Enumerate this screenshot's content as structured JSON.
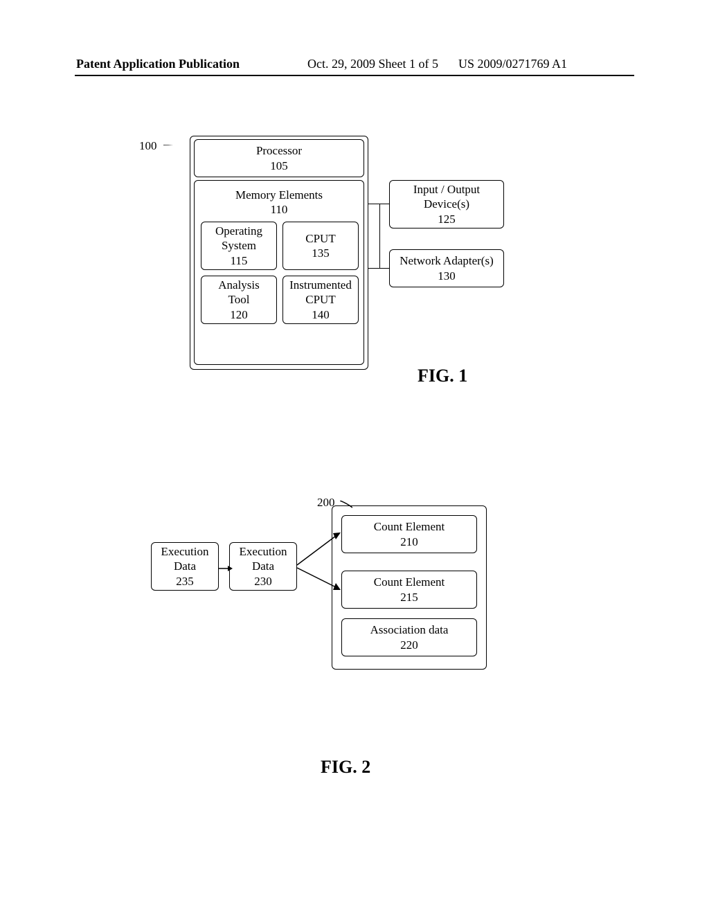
{
  "header": {
    "left": "Patent Application Publication",
    "middle": "Oct. 29, 2009  Sheet 1 of 5",
    "right": "US 2009/0271769 A1"
  },
  "fig1": {
    "ref_main": "100",
    "caption": "FIG. 1",
    "processor": {
      "label": "Processor",
      "num": "105"
    },
    "memory": {
      "label": "Memory Elements",
      "num": "110"
    },
    "os": {
      "label": "Operating\nSystem",
      "num": "115"
    },
    "cput": {
      "label": "CPUT",
      "num": "135"
    },
    "analysis": {
      "label": "Analysis\nTool",
      "num": "120"
    },
    "instrumented": {
      "label": "Instrumented\nCPUT",
      "num": "140"
    },
    "io": {
      "label": "Input / Output\nDevice(s)",
      "num": "125"
    },
    "net": {
      "label": "Network Adapter(s)",
      "num": "130"
    }
  },
  "fig2": {
    "ref_container": "200",
    "caption": "FIG. 2",
    "count1": {
      "label": "Count Element",
      "num": "210"
    },
    "count2": {
      "label": "Count Element",
      "num": "215"
    },
    "assoc": {
      "label": "Association data",
      "num": "220"
    },
    "exec230": {
      "label": "Execution\nData",
      "num": "230"
    },
    "exec235": {
      "label": "Execution\nData",
      "num": "235"
    }
  }
}
